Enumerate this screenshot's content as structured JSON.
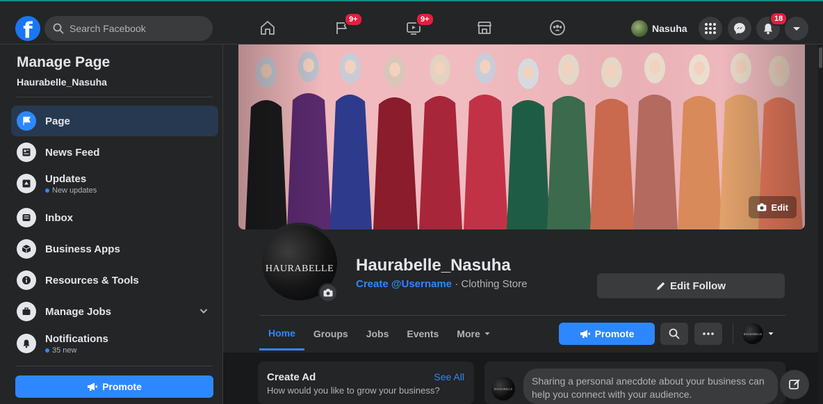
{
  "topbar": {
    "logo_letter": "f",
    "search_placeholder": "Search Facebook",
    "nav_badges": {
      "pages": "9+",
      "watch": "9+"
    },
    "user_name": "Nasuha",
    "notifications_count": "18"
  },
  "sidebar": {
    "title": "Manage Page",
    "page_name": "Haurabelle_Nasuha",
    "items": [
      {
        "label": "Page",
        "icon": "flag-icon",
        "active": true
      },
      {
        "label": "News Feed",
        "icon": "news-feed-icon"
      },
      {
        "label": "Updates",
        "icon": "updates-icon",
        "note": "New updates"
      },
      {
        "label": "Inbox",
        "icon": "inbox-icon"
      },
      {
        "label": "Business Apps",
        "icon": "cube-icon"
      },
      {
        "label": "Resources & Tools",
        "icon": "info-icon"
      },
      {
        "label": "Manage Jobs",
        "icon": "briefcase-icon"
      },
      {
        "label": "Notifications",
        "icon": "bell-icon",
        "note": "35 new"
      }
    ],
    "promote_label": "Promote"
  },
  "header": {
    "cover_edit_label": "Edit",
    "profile_brand": "HAURABELLE",
    "page_name": "Haurabelle_Nasuha",
    "username_link": "Create @Username",
    "category": "· Clothing Store",
    "edit_follow_label": "Edit Follow",
    "tabs": [
      "Home",
      "Groups",
      "Jobs",
      "Events",
      "More"
    ],
    "promote_label": "Promote",
    "mini_brand": "HAURABELLE"
  },
  "cards": {
    "create_ad_title": "Create Ad",
    "see_all": "See All",
    "create_ad_sub": "How would you like to grow your business?",
    "post_brand": "HAURABELLE",
    "post_prompt": "Sharing a personal anecdote about your business can help you connect with your audience."
  },
  "colors": {
    "accent": "#2d88ff",
    "badge": "#e41e3f",
    "surface": "#242526",
    "background": "#18191a"
  }
}
